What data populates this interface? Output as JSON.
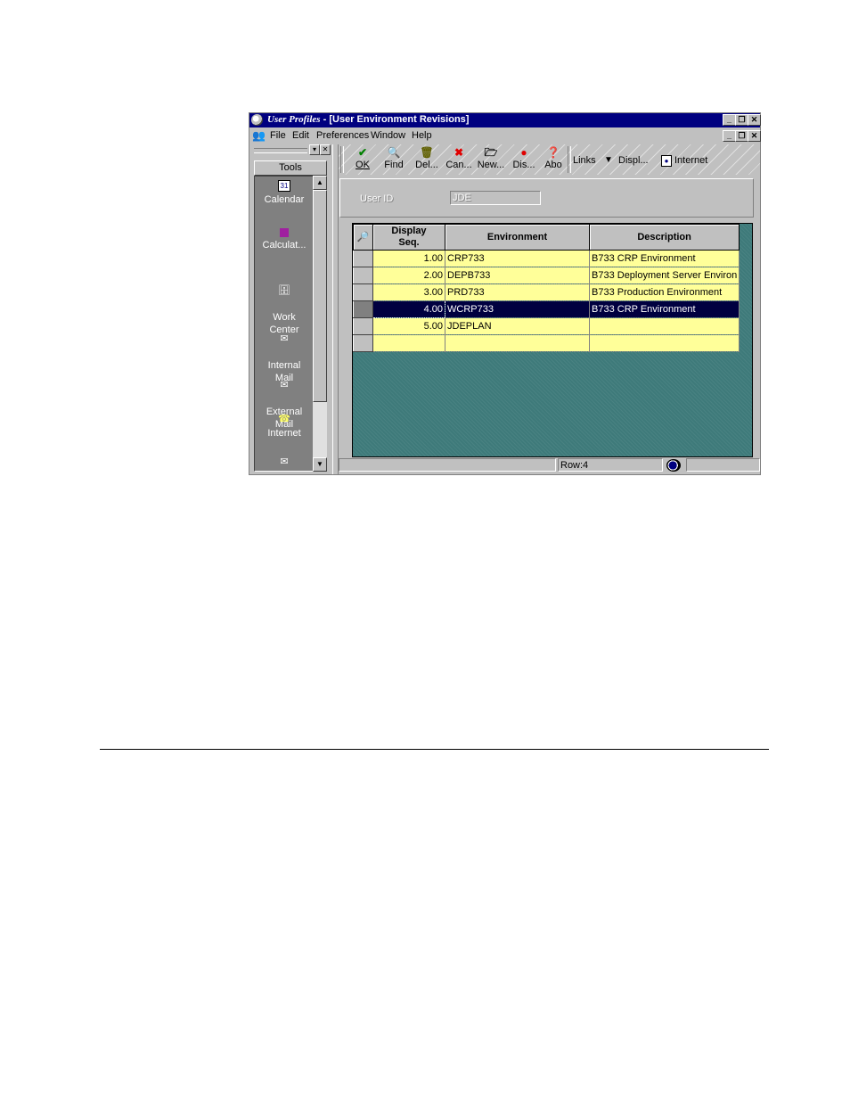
{
  "window": {
    "title_app": "User Profiles",
    "title_rest": " - [User Environment Revisions]",
    "controls": [
      "_",
      "❐",
      "✕"
    ]
  },
  "menu": {
    "items": [
      "File",
      "Edit",
      "Preferences",
      "Window",
      "Help"
    ]
  },
  "tools_panel": {
    "header": "Tools",
    "items": [
      {
        "label": "Calendar",
        "icon": "calendar-icon"
      },
      {
        "label": "Calculat...",
        "icon": "calculator-icon"
      },
      {
        "label": "Work\nCenter",
        "icon": "work-center-icon"
      },
      {
        "label": "Internal\nMail",
        "icon": "internal-mail-icon"
      },
      {
        "label": "External\nMail",
        "icon": "external-mail-icon"
      },
      {
        "label": "Internet",
        "icon": "internet-icon"
      },
      {
        "label": "",
        "icon": "mail-icon"
      }
    ]
  },
  "toolbar": {
    "ok": "OK",
    "find": "Find",
    "delete": "Del...",
    "cancel": "Can...",
    "new": "New...",
    "display": "Dis...",
    "about": "Abo",
    "links": "Links",
    "displ": "Displ...",
    "internet": "Internet"
  },
  "form": {
    "user_id_label": "User ID",
    "user_id_value": "JDE"
  },
  "grid": {
    "headers": {
      "seq": "Display\nSeq.",
      "environment": "Environment",
      "description": "Description"
    },
    "rows": [
      {
        "seq": "1.00",
        "environment": "CRP733",
        "description": "B733 CRP Environment"
      },
      {
        "seq": "2.00",
        "environment": "DEPB733",
        "description": "B733 Deployment Server Environ"
      },
      {
        "seq": "3.00",
        "environment": "PRD733",
        "description": "B733 Production Environment"
      },
      {
        "seq": "4.00",
        "environment": "WCRP733",
        "description": "B733 CRP Environment"
      },
      {
        "seq": "5.00",
        "environment": "JDEPLAN",
        "description": ""
      },
      {
        "seq": "",
        "environment": "",
        "description": ""
      }
    ],
    "selected_row_index": 3
  },
  "status": {
    "row": "Row:4"
  }
}
